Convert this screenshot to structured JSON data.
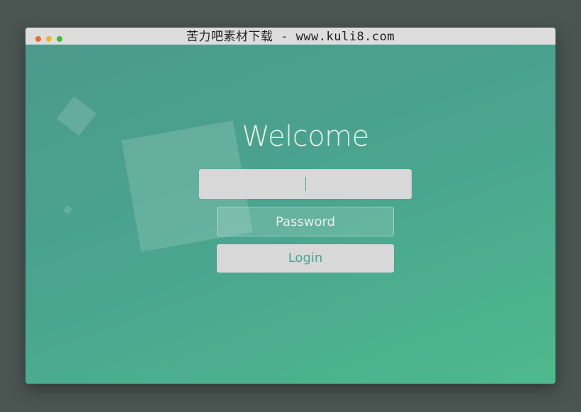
{
  "window": {
    "title": "苦力吧素材下载 - www.kuli8.com",
    "traffic_lights": [
      {
        "name": "close-dot",
        "color": "#f1692c"
      },
      {
        "name": "minimize-dot",
        "color": "#e8bb2a"
      },
      {
        "name": "maximize-dot",
        "color": "#3dbb3c"
      }
    ]
  },
  "login": {
    "heading": "Welcome",
    "username_value": "",
    "password_placeholder": "Password",
    "login_label": "Login"
  },
  "colors": {
    "accent": "#4aa58f",
    "field_bg": "#d8d8d8"
  }
}
